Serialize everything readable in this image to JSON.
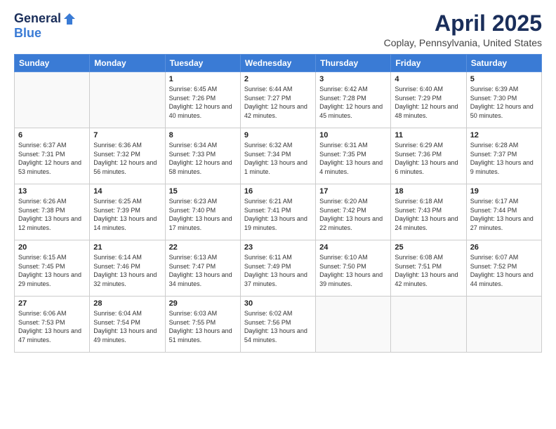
{
  "logo": {
    "general": "General",
    "blue": "Blue"
  },
  "header": {
    "title": "April 2025",
    "subtitle": "Coplay, Pennsylvania, United States"
  },
  "weekdays": [
    "Sunday",
    "Monday",
    "Tuesday",
    "Wednesday",
    "Thursday",
    "Friday",
    "Saturday"
  ],
  "weeks": [
    [
      {
        "day": "",
        "info": ""
      },
      {
        "day": "",
        "info": ""
      },
      {
        "day": "1",
        "info": "Sunrise: 6:45 AM\nSunset: 7:26 PM\nDaylight: 12 hours and 40 minutes."
      },
      {
        "day": "2",
        "info": "Sunrise: 6:44 AM\nSunset: 7:27 PM\nDaylight: 12 hours and 42 minutes."
      },
      {
        "day": "3",
        "info": "Sunrise: 6:42 AM\nSunset: 7:28 PM\nDaylight: 12 hours and 45 minutes."
      },
      {
        "day": "4",
        "info": "Sunrise: 6:40 AM\nSunset: 7:29 PM\nDaylight: 12 hours and 48 minutes."
      },
      {
        "day": "5",
        "info": "Sunrise: 6:39 AM\nSunset: 7:30 PM\nDaylight: 12 hours and 50 minutes."
      }
    ],
    [
      {
        "day": "6",
        "info": "Sunrise: 6:37 AM\nSunset: 7:31 PM\nDaylight: 12 hours and 53 minutes."
      },
      {
        "day": "7",
        "info": "Sunrise: 6:36 AM\nSunset: 7:32 PM\nDaylight: 12 hours and 56 minutes."
      },
      {
        "day": "8",
        "info": "Sunrise: 6:34 AM\nSunset: 7:33 PM\nDaylight: 12 hours and 58 minutes."
      },
      {
        "day": "9",
        "info": "Sunrise: 6:32 AM\nSunset: 7:34 PM\nDaylight: 13 hours and 1 minute."
      },
      {
        "day": "10",
        "info": "Sunrise: 6:31 AM\nSunset: 7:35 PM\nDaylight: 13 hours and 4 minutes."
      },
      {
        "day": "11",
        "info": "Sunrise: 6:29 AM\nSunset: 7:36 PM\nDaylight: 13 hours and 6 minutes."
      },
      {
        "day": "12",
        "info": "Sunrise: 6:28 AM\nSunset: 7:37 PM\nDaylight: 13 hours and 9 minutes."
      }
    ],
    [
      {
        "day": "13",
        "info": "Sunrise: 6:26 AM\nSunset: 7:38 PM\nDaylight: 13 hours and 12 minutes."
      },
      {
        "day": "14",
        "info": "Sunrise: 6:25 AM\nSunset: 7:39 PM\nDaylight: 13 hours and 14 minutes."
      },
      {
        "day": "15",
        "info": "Sunrise: 6:23 AM\nSunset: 7:40 PM\nDaylight: 13 hours and 17 minutes."
      },
      {
        "day": "16",
        "info": "Sunrise: 6:21 AM\nSunset: 7:41 PM\nDaylight: 13 hours and 19 minutes."
      },
      {
        "day": "17",
        "info": "Sunrise: 6:20 AM\nSunset: 7:42 PM\nDaylight: 13 hours and 22 minutes."
      },
      {
        "day": "18",
        "info": "Sunrise: 6:18 AM\nSunset: 7:43 PM\nDaylight: 13 hours and 24 minutes."
      },
      {
        "day": "19",
        "info": "Sunrise: 6:17 AM\nSunset: 7:44 PM\nDaylight: 13 hours and 27 minutes."
      }
    ],
    [
      {
        "day": "20",
        "info": "Sunrise: 6:15 AM\nSunset: 7:45 PM\nDaylight: 13 hours and 29 minutes."
      },
      {
        "day": "21",
        "info": "Sunrise: 6:14 AM\nSunset: 7:46 PM\nDaylight: 13 hours and 32 minutes."
      },
      {
        "day": "22",
        "info": "Sunrise: 6:13 AM\nSunset: 7:47 PM\nDaylight: 13 hours and 34 minutes."
      },
      {
        "day": "23",
        "info": "Sunrise: 6:11 AM\nSunset: 7:49 PM\nDaylight: 13 hours and 37 minutes."
      },
      {
        "day": "24",
        "info": "Sunrise: 6:10 AM\nSunset: 7:50 PM\nDaylight: 13 hours and 39 minutes."
      },
      {
        "day": "25",
        "info": "Sunrise: 6:08 AM\nSunset: 7:51 PM\nDaylight: 13 hours and 42 minutes."
      },
      {
        "day": "26",
        "info": "Sunrise: 6:07 AM\nSunset: 7:52 PM\nDaylight: 13 hours and 44 minutes."
      }
    ],
    [
      {
        "day": "27",
        "info": "Sunrise: 6:06 AM\nSunset: 7:53 PM\nDaylight: 13 hours and 47 minutes."
      },
      {
        "day": "28",
        "info": "Sunrise: 6:04 AM\nSunset: 7:54 PM\nDaylight: 13 hours and 49 minutes."
      },
      {
        "day": "29",
        "info": "Sunrise: 6:03 AM\nSunset: 7:55 PM\nDaylight: 13 hours and 51 minutes."
      },
      {
        "day": "30",
        "info": "Sunrise: 6:02 AM\nSunset: 7:56 PM\nDaylight: 13 hours and 54 minutes."
      },
      {
        "day": "",
        "info": ""
      },
      {
        "day": "",
        "info": ""
      },
      {
        "day": "",
        "info": ""
      }
    ]
  ]
}
